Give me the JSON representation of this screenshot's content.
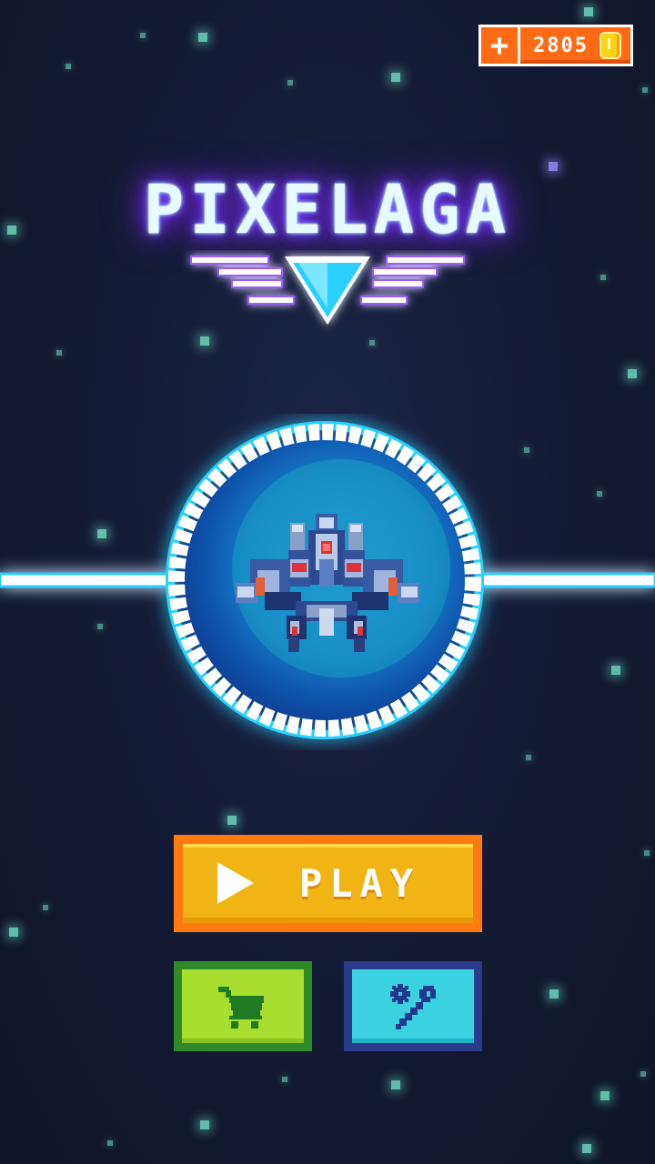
{
  "game": {
    "logo_text": "PIXELAGA"
  },
  "currency": {
    "coins": "2805",
    "add_symbol": "+"
  },
  "menu": {
    "play_label": "PLAY"
  },
  "colors": {
    "play_outer": "#ff7a10",
    "play_inner": "#f0b414",
    "shop": "#a7de30",
    "settings": "#3ad2e0",
    "coin_bg": "#ff6a14",
    "portal_glow": "#2ad0ff"
  },
  "icons": [
    "plus-icon",
    "coin-icon",
    "play-icon",
    "cart-icon",
    "gear-wrench-icon",
    "spaceship-sprite",
    "wings-emblem"
  ]
}
